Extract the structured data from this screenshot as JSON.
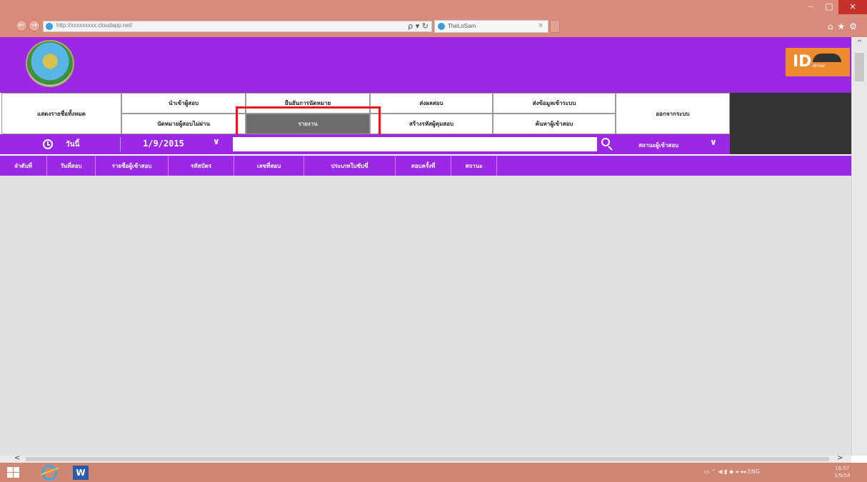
{
  "browser": {
    "url": "http://xxxxxxxxx.cloudapp.net/",
    "tab_title": "TheLoSam",
    "address_tools": "ρ ▾ ↻",
    "tab_close": "×",
    "back": "←",
    "forward": "→",
    "window_controls": {
      "minimize": "–",
      "maximize": "□",
      "close": "×"
    },
    "toolbar_icons": "⌂★⚙"
  },
  "header": {
    "brand_logo_text": "ID",
    "brand_logo_sub": "driver"
  },
  "menu": {
    "show_all": "แสดงรายชื่อทั้งหมด",
    "row1": [
      "นำเข้าผู้สอบ",
      "ยืนยันการนัดหมาย",
      "ส่งผลสอบ",
      "ส่งข้อมูลเข้าระบบ"
    ],
    "row2": [
      "นัดหมายผู้สอบไม่ผ่าน",
      "รายงาน",
      "สร้างรหัสผู้คุมสอบ",
      "ค้นหาผู้เข้าสอบ"
    ],
    "logout": "ออกจากระบบ",
    "active_item": "รายงาน"
  },
  "filter": {
    "day_label": "วันนี้",
    "date": "1/9/2015",
    "chevron": "∨",
    "search_placeholder": "",
    "status_label": "สถานะผู้เข้าสอบ",
    "status_chevron": "∨"
  },
  "table": {
    "columns": [
      "ลำดับที่",
      "วันที่สอบ",
      "รายชื่อผู้เข้าสอบ",
      "รหัสบัตร",
      "เลขที่สอบ",
      "ประเภทใบขับขี่",
      "สอบครั้งที่",
      "สถานะ"
    ]
  },
  "scroll": {
    "up": "^",
    "left": "<",
    "right": ">"
  },
  "taskbar": {
    "word_label": "W",
    "tray_text": "▭  ⌃  ◀  ▮  ◆  ◂  ◂◂  ENG",
    "clock_time": "16:57",
    "clock_date": "1/9/58"
  },
  "colors": {
    "purple": "#9b28e6",
    "dark": "#333333",
    "highlight": "#e6191f",
    "active_menu": "#6c6c6c",
    "brand_orange": "#ee8a2e"
  }
}
